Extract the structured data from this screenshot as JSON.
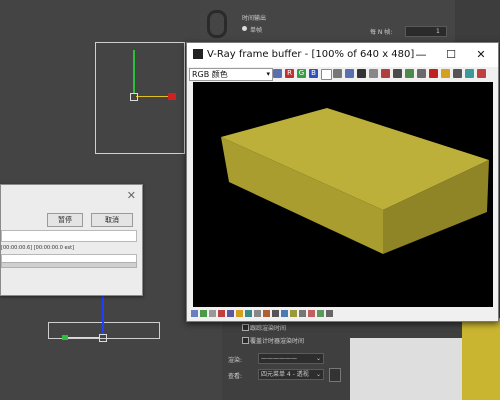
{
  "vfb": {
    "title": "V-Ray frame buffer - [100% of 640 x 480]",
    "channel": "RGB 颜色",
    "minimize": "—",
    "maximize": "☐",
    "close": "✕",
    "toolbar_letters": {
      "r": "R",
      "g": "G",
      "b": "B"
    }
  },
  "dialog": {
    "close": "✕",
    "pause_label": "暂停",
    "cancel_label": "取消",
    "time_text": "[00:00:00.6] [00:00:00.0 est]"
  },
  "top_panel": {
    "group_label": "时间输出",
    "single_label": "单帧",
    "every_n_label": "每 N 帧:",
    "every_n_value": "1"
  },
  "bottom_panel": {
    "checkbox1_label": "跟踪渲染时间",
    "checkbox2_label": "覆盖计时器渲染时间",
    "renderer_label": "渲染:",
    "renderer_value": "——————",
    "view_label": "查看:",
    "view_value": "四元菜单 4 - 透视"
  },
  "colors": {
    "box_top": "#bdb03a",
    "box_front": "#a99d30",
    "box_side": "#8f8426",
    "viewport_bg": "#444444"
  }
}
